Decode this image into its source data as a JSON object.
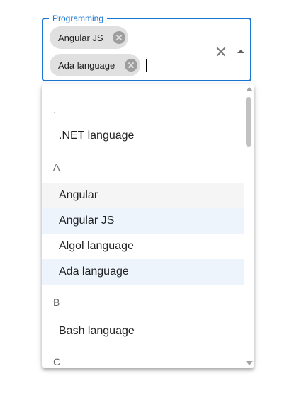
{
  "field": {
    "label": "Programming",
    "chips": [
      {
        "label": "Angular JS",
        "delete_icon": "cancel-icon"
      },
      {
        "label": "Ada language",
        "delete_icon": "cancel-icon"
      }
    ],
    "input_value": "",
    "clear_icon": "close-icon",
    "popup_icon": "arrow-drop-up-icon"
  },
  "listbox": {
    "groups": [
      {
        "header": ".",
        "options": [
          ".NET language"
        ]
      },
      {
        "header": "A",
        "options": [
          "Angular",
          "Angular JS",
          "Algol language",
          "Ada language"
        ]
      },
      {
        "header": "B",
        "options": [
          "Bash language"
        ]
      },
      {
        "header": "C",
        "options": []
      }
    ]
  },
  "colors": {
    "accent": "#1976d2",
    "chip_background": "#e0e0e0",
    "option_hover": "#f5f5f5",
    "option_selected": "#edf4fc"
  }
}
